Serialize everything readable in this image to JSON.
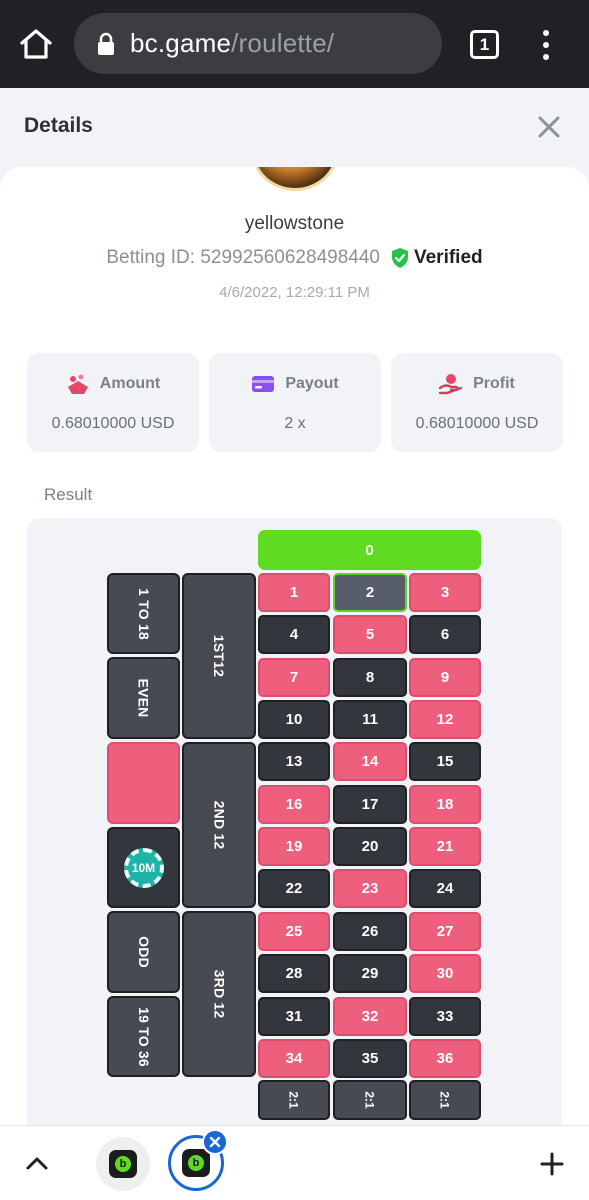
{
  "browser": {
    "url_domain": "bc.game",
    "url_path": "/roulette/",
    "tab_count": "1"
  },
  "modal": {
    "title": "Details"
  },
  "bet": {
    "username": "yellowstone",
    "betting_id": "Betting ID: 52992560628498440",
    "verified_label": "Verified",
    "timestamp": "4/6/2022, 12:29:11 PM"
  },
  "stats": {
    "amount": {
      "label": "Amount",
      "value": "0.68010000 USD",
      "icon": "amount-icon"
    },
    "payout": {
      "label": "Payout",
      "value": "2 x",
      "icon": "card-icon"
    },
    "profit": {
      "label": "Profit",
      "value": "0.68010000 USD",
      "icon": "profit-icon"
    }
  },
  "result": {
    "label": "Result",
    "zero": "0",
    "selected_number": "2",
    "rows": [
      [
        {
          "n": "1",
          "c": "red"
        },
        {
          "n": "2",
          "c": "sel"
        },
        {
          "n": "3",
          "c": "red"
        }
      ],
      [
        {
          "n": "4",
          "c": "black"
        },
        {
          "n": "5",
          "c": "red"
        },
        {
          "n": "6",
          "c": "black"
        }
      ],
      [
        {
          "n": "7",
          "c": "red"
        },
        {
          "n": "8",
          "c": "black"
        },
        {
          "n": "9",
          "c": "red"
        }
      ],
      [
        {
          "n": "10",
          "c": "black"
        },
        {
          "n": "11",
          "c": "black"
        },
        {
          "n": "12",
          "c": "red"
        }
      ],
      [
        {
          "n": "13",
          "c": "black"
        },
        {
          "n": "14",
          "c": "red"
        },
        {
          "n": "15",
          "c": "black"
        }
      ],
      [
        {
          "n": "16",
          "c": "red"
        },
        {
          "n": "17",
          "c": "black"
        },
        {
          "n": "18",
          "c": "red"
        }
      ],
      [
        {
          "n": "19",
          "c": "red"
        },
        {
          "n": "20",
          "c": "black"
        },
        {
          "n": "21",
          "c": "red"
        }
      ],
      [
        {
          "n": "22",
          "c": "black"
        },
        {
          "n": "23",
          "c": "red"
        },
        {
          "n": "24",
          "c": "black"
        }
      ],
      [
        {
          "n": "25",
          "c": "red"
        },
        {
          "n": "26",
          "c": "black"
        },
        {
          "n": "27",
          "c": "red"
        }
      ],
      [
        {
          "n": "28",
          "c": "black"
        },
        {
          "n": "29",
          "c": "black"
        },
        {
          "n": "30",
          "c": "red"
        }
      ],
      [
        {
          "n": "31",
          "c": "black"
        },
        {
          "n": "32",
          "c": "red"
        },
        {
          "n": "33",
          "c": "black"
        }
      ],
      [
        {
          "n": "34",
          "c": "red"
        },
        {
          "n": "35",
          "c": "black"
        },
        {
          "n": "36",
          "c": "red"
        }
      ]
    ],
    "dozens": [
      "1ST12",
      "2ND 12",
      "3RD 12"
    ],
    "outside": {
      "low": "1 TO 18",
      "even": "EVEN",
      "chip": "10M",
      "odd": "ODD",
      "high": "19 TO 36"
    },
    "column_bets": [
      "2:1",
      "2:1",
      "2:1"
    ]
  },
  "colors": {
    "red": "#ee5f7e",
    "black": "#33363c",
    "green": "#5fdb22",
    "selected_border": "#59d42a",
    "tab_blue": "#1a67d2"
  }
}
